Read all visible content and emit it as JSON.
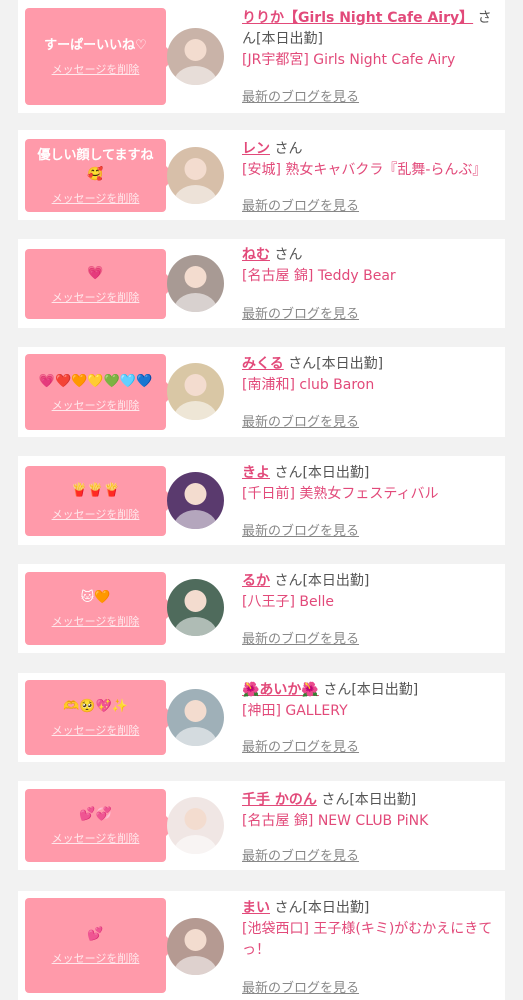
{
  "items": [
    {
      "message": "すーぱーいいね♡",
      "delete": "メッセージを削除",
      "name": "りりか【Girls Night Cafe Airy】",
      "suffix": "さん[本日出勤]",
      "shop": "[JR宇都宮] Girls Night Cafe Airy",
      "blog": "最新のブログを見る",
      "avatar_color": "#c9b3a8"
    },
    {
      "message": "優しい顔してますね🥰",
      "delete": "メッセージを削除",
      "name": "レン",
      "suffix": "さん",
      "shop": "[安城] 熟女キャバクラ『乱舞-らんぶ』",
      "blog": "最新のブログを見る",
      "avatar_color": "#d7bfa9"
    },
    {
      "message": "💗",
      "delete": "メッセージを削除",
      "name": "ねむ",
      "suffix": "さん",
      "shop": "[名古屋 錦] Teddy Bear",
      "blog": "最新のブログを見る",
      "avatar_color": "#a89a94"
    },
    {
      "message": "💗❤️🧡💛💚🩵💙",
      "delete": "メッセージを削除",
      "name": "みくる",
      "suffix": "さん[本日出勤]",
      "shop": "[南浦和] club Baron",
      "blog": "最新のブログを見る",
      "avatar_color": "#d9c7a5"
    },
    {
      "message": "🍟🍟🍟",
      "delete": "メッセージを削除",
      "name": "きよ",
      "suffix": "さん[本日出勤]",
      "shop": "[千日前] 美熟女フェスティバル",
      "blog": "最新のブログを見る",
      "avatar_color": "#5a3a6e"
    },
    {
      "message": "🐱🧡",
      "delete": "メッセージを削除",
      "name": "るか",
      "suffix": "さん[本日出勤]",
      "shop": "[八王子] Belle",
      "blog": "最新のブログを見る",
      "avatar_color": "#4f6b5c"
    },
    {
      "message": "🫶🥺💖✨",
      "delete": "メッセージを削除",
      "name": "🌺あいか🌺",
      "suffix": "さん[本日出勤]",
      "shop": "[神田] GALLERY",
      "blog": "最新のブログを見る",
      "avatar_color": "#9fb0b8"
    },
    {
      "message": "💕💞",
      "delete": "メッセージを削除",
      "name": "千手 かのん",
      "suffix": "さん[本日出勤]",
      "shop": "[名古屋 錦] NEW CLUB PiNK",
      "blog": "最新のブログを見る",
      "avatar_color": "#f0e6e4"
    },
    {
      "message": "💕",
      "delete": "メッセージを削除",
      "name": "まい",
      "suffix": "さん[本日出勤]",
      "shop": "[池袋西口] 王子様(キミ)がむかえにきてっ！",
      "blog": "最新のブログを見る",
      "avatar_color": "#b59a92"
    }
  ]
}
